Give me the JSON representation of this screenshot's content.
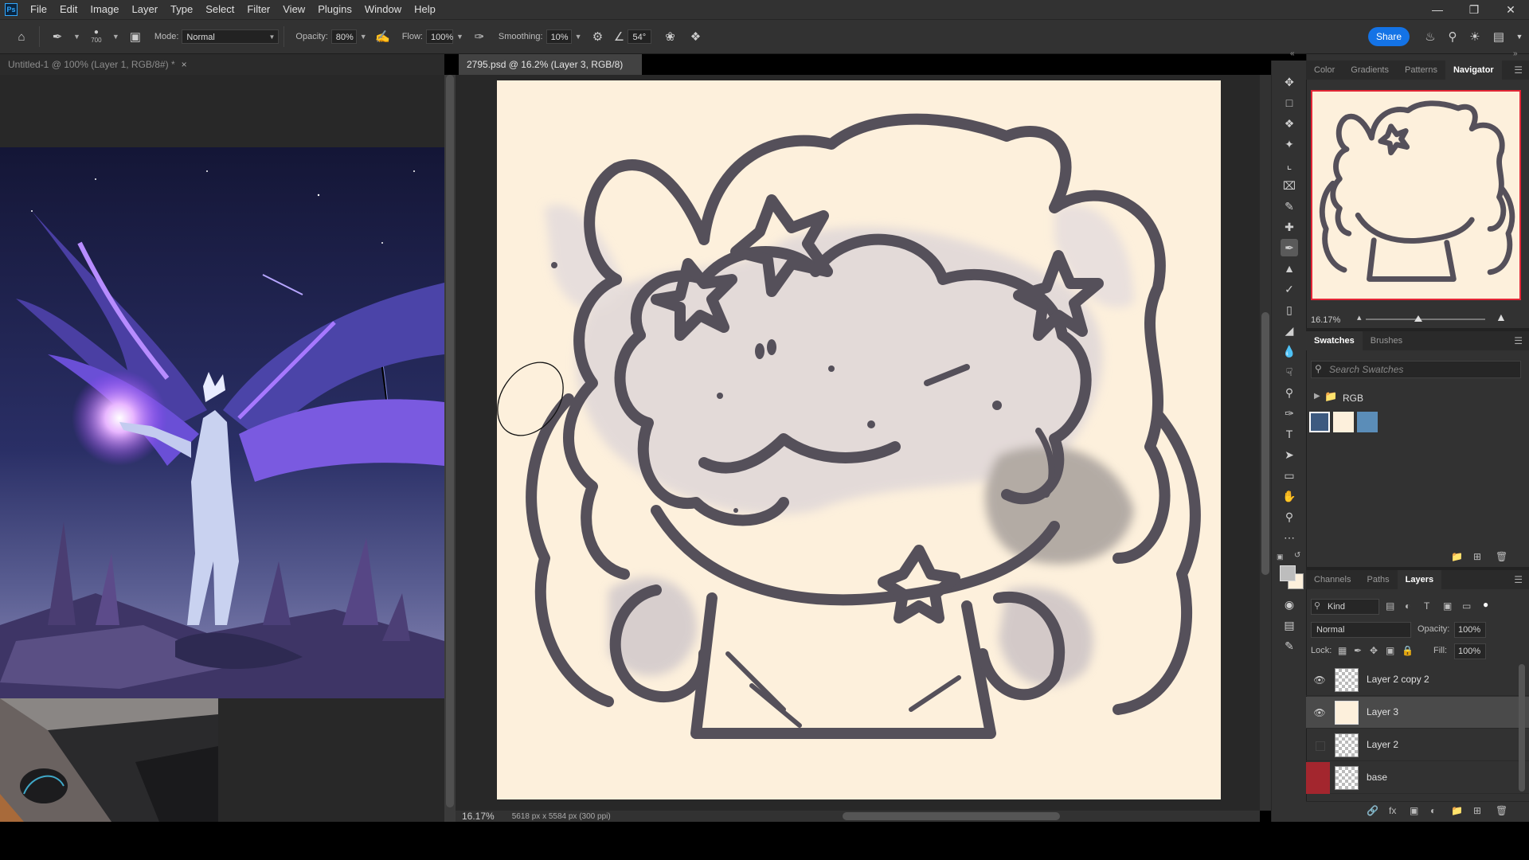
{
  "menubar": {
    "logo": "Ps",
    "items": [
      "File",
      "Edit",
      "Image",
      "Layer",
      "Type",
      "Select",
      "Filter",
      "View",
      "Plugins",
      "Window",
      "Help"
    ]
  },
  "options": {
    "brush_size": "700",
    "mode_label": "Mode:",
    "mode_value": "Normal",
    "opacity_label": "Opacity:",
    "opacity_value": "80%",
    "flow_label": "Flow:",
    "flow_value": "100%",
    "smoothing_label": "Smoothing:",
    "smoothing_value": "10%",
    "angle_value": "54°",
    "share_label": "Share"
  },
  "tabs": [
    {
      "label": "Untitled-1 @ 100% (Layer 1, RGB/8#) *"
    },
    {
      "label": "2795.psd @ 16.2% (Layer 3, RGB/8) *"
    }
  ],
  "status": {
    "zoom": "16.17%",
    "dimensions": "5618 px x 5584 px (300 ppi)"
  },
  "panels": {
    "top_tabs": [
      "Color",
      "Gradients",
      "Patterns",
      "Navigator"
    ],
    "nav_zoom": "16.17%",
    "swatch_tabs": [
      "Swatches",
      "Brushes"
    ],
    "swatch_search_placeholder": "Search Swatches",
    "swatch_group": "RGB",
    "swatch_colors": [
      "#3d5a80",
      "#fdf0dc",
      "#5b8db8"
    ],
    "layer_tabs": [
      "Channels",
      "Paths",
      "Layers"
    ],
    "filter_kind": "Kind",
    "blend_mode": "Normal",
    "opacity_label": "Opacity:",
    "opacity_value": "100%",
    "lock_label": "Lock:",
    "fill_label": "Fill:",
    "fill_value": "100%",
    "layers": [
      {
        "name": "Layer 2 copy 2",
        "visible": true
      },
      {
        "name": "Layer 3",
        "visible": true
      },
      {
        "name": "Layer 2",
        "visible": false
      },
      {
        "name": "base",
        "visible": false
      }
    ]
  },
  "colors": {
    "accent": "#1473e6",
    "canvas_bg": "#fdf0dc",
    "nav_frame": "#e32636",
    "base_layer_tag": "#a3262e"
  }
}
